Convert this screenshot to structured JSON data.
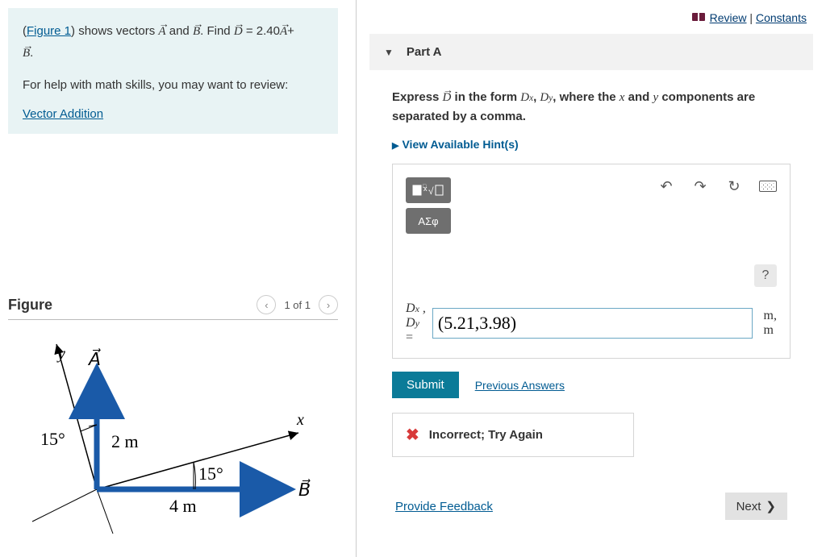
{
  "problem": {
    "figure_link": "Figure 1",
    "sentence_part1": ") shows vectors ",
    "sentence_part2": " and ",
    "sentence_part3": ". Find ",
    "equation_rhs": " = 2.40",
    "plus": "+",
    "period": ".",
    "help_text": "For help with math skills, you may want to review:",
    "help_link": "Vector Addition"
  },
  "figure": {
    "heading": "Figure",
    "pager": "1 of 1",
    "labels": {
      "y": "y",
      "x": "x",
      "A": "A",
      "B": "B",
      "angle1": "15°",
      "angle2": "15°",
      "len1": "2 m",
      "len2": "4 m"
    }
  },
  "top_links": {
    "review": "Review",
    "sep": " | ",
    "constants": "Constants"
  },
  "part": {
    "title": "Part A",
    "prompt_pre": "Express ",
    "prompt_mid1": " in the form ",
    "dx": "D",
    "dx_sub": "x",
    "comma": ", ",
    "dy": "D",
    "dy_sub": "y",
    "prompt_mid2": ", where the ",
    "xvar": "x",
    "and": " and ",
    "yvar": "y",
    "prompt_end": " components are separated by a comma.",
    "hints": "View Available Hint(s)"
  },
  "toolbar": {
    "greek": "ΑΣφ",
    "help": "?"
  },
  "answer": {
    "label_dx": "D",
    "label_dx_sub": "x",
    "label_dy": "D",
    "label_dy_sub": "y",
    "equals": "=",
    "value": "(5.21,3.98)",
    "units_top": "m,",
    "units_bot": "m"
  },
  "actions": {
    "submit": "Submit",
    "previous": "Previous Answers"
  },
  "feedback": {
    "text": "Incorrect; Try Again"
  },
  "footer": {
    "feedback_link": "Provide Feedback",
    "next": "Next"
  }
}
